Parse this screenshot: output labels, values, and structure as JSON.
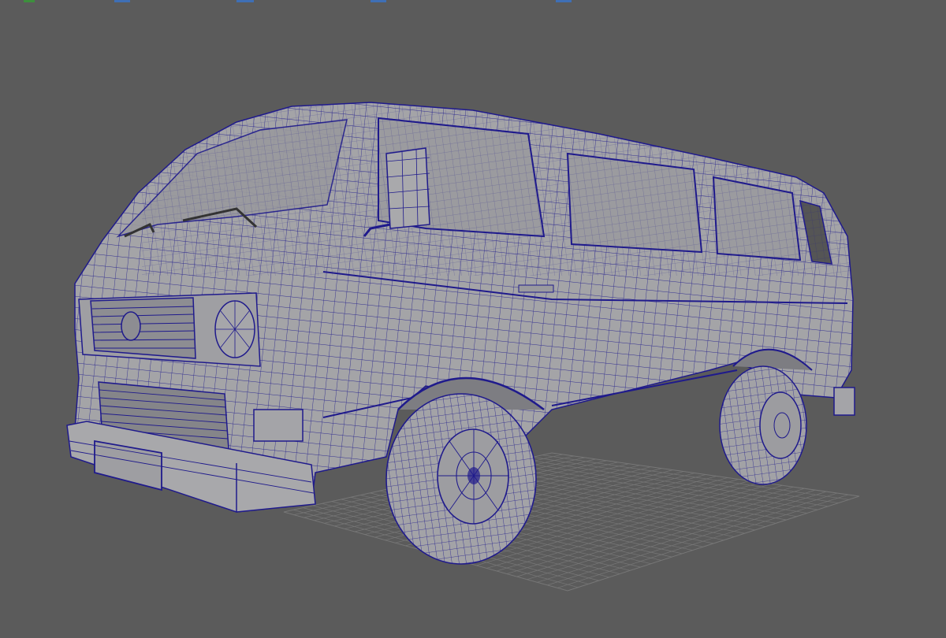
{
  "viewport": {
    "background": "#5b5b5b",
    "model_surface": "#a3a3a6",
    "model_surface_dark": "#8e8e92",
    "wire_color": "#1f1a8c",
    "grid_color": "#767676",
    "strip_colors": [
      "#3d8f3d",
      "#3f6fb5",
      "#3f6fb5",
      "#3f6fb5",
      "#3f6fb5"
    ]
  },
  "model": {
    "object": "van",
    "view": "perspective",
    "display_mode": "wireframe-on-shaded",
    "badge_text": ""
  }
}
